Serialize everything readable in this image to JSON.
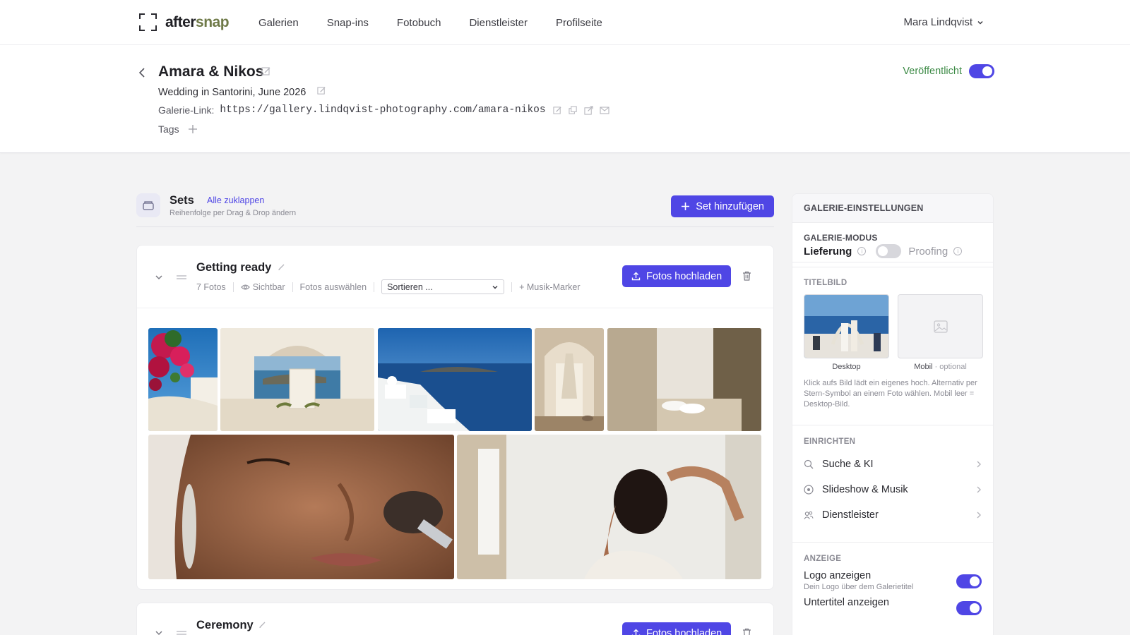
{
  "nav": {
    "logo_part1": "after",
    "logo_part2": "snap",
    "items": [
      "Galerien",
      "Snap-ins",
      "Fotobuch",
      "Dienstleister",
      "Profilseite"
    ],
    "user": "Mara Lindqvist"
  },
  "header": {
    "title": "Amara & Nikos",
    "subtitle": "Wedding in Santorini, June 2026",
    "link_label": "Galerie-Link:",
    "link_url": "https://gallery.lindqvist-photography.com/amara-nikos",
    "tags_label": "Tags",
    "published_label": "Veröffentlicht",
    "published": true
  },
  "sets": {
    "title": "Sets",
    "collapse_all": "Alle zuklappen",
    "hint": "Reihenfolge per Drag & Drop ändern",
    "add_button": "Set hinzufügen",
    "items": [
      {
        "name": "Getting ready",
        "count": "7 Fotos",
        "visibility": "Sichtbar",
        "select": "Fotos auswählen",
        "sort_placeholder": "Sortieren ...",
        "music": "+ Musik-Marker",
        "upload": "Fotos hochladen"
      },
      {
        "name": "Ceremony",
        "upload": "Fotos hochladen"
      }
    ]
  },
  "panel": {
    "title": "GALERIE-EINSTELLUNGEN",
    "mode": {
      "title": "GALERIE-MODUS",
      "option_on": "Lieferung",
      "option_off": "Proofing"
    },
    "cover": {
      "title": "TITELBILD",
      "desktop": "Desktop",
      "mobile": "Mobil",
      "mobile_optional": "· optional",
      "hint": "Klick aufs Bild lädt ein eigenes hoch. Alternativ per Stern-Symbol an einem Foto wählen. Mobil leer = Desktop-Bild."
    },
    "setup": {
      "title": "EINRICHTEN",
      "items": [
        "Suche & KI",
        "Slideshow & Musik",
        "Dienstleister"
      ]
    },
    "display": {
      "title": "ANZEIGE",
      "items": [
        {
          "label": "Logo anzeigen",
          "desc": "Dein Logo über dem Galerietitel",
          "on": true
        },
        {
          "label": "Untertitel anzeigen",
          "desc": "",
          "on": true
        }
      ]
    }
  },
  "colors": {
    "accent": "#4f46e5",
    "published_green": "#3c8a45",
    "logo_snap": "#6f7a48"
  }
}
